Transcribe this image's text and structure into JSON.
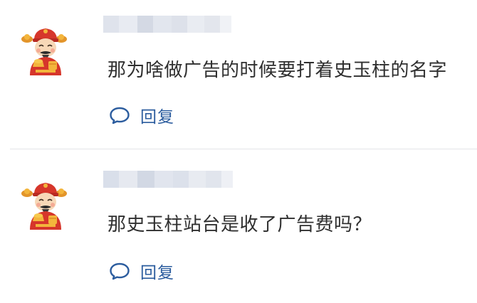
{
  "comments": [
    {
      "avatar_icon": "fortune-god-avatar-icon",
      "username_state": "blurred",
      "text": "那为啥做广告的时候要打着史玉柱的名字",
      "reply_label": "回复",
      "reply_icon": "speech-bubble-icon"
    },
    {
      "avatar_icon": "fortune-god-avatar-icon",
      "username_state": "blurred",
      "text": "那史玉柱站台是收了广告费吗？",
      "reply_label": "回复",
      "reply_icon": "speech-bubble-icon"
    }
  ],
  "colors": {
    "accent": "#2b5c9e",
    "text": "#2f2f2f",
    "divider": "#e3e5e8"
  }
}
